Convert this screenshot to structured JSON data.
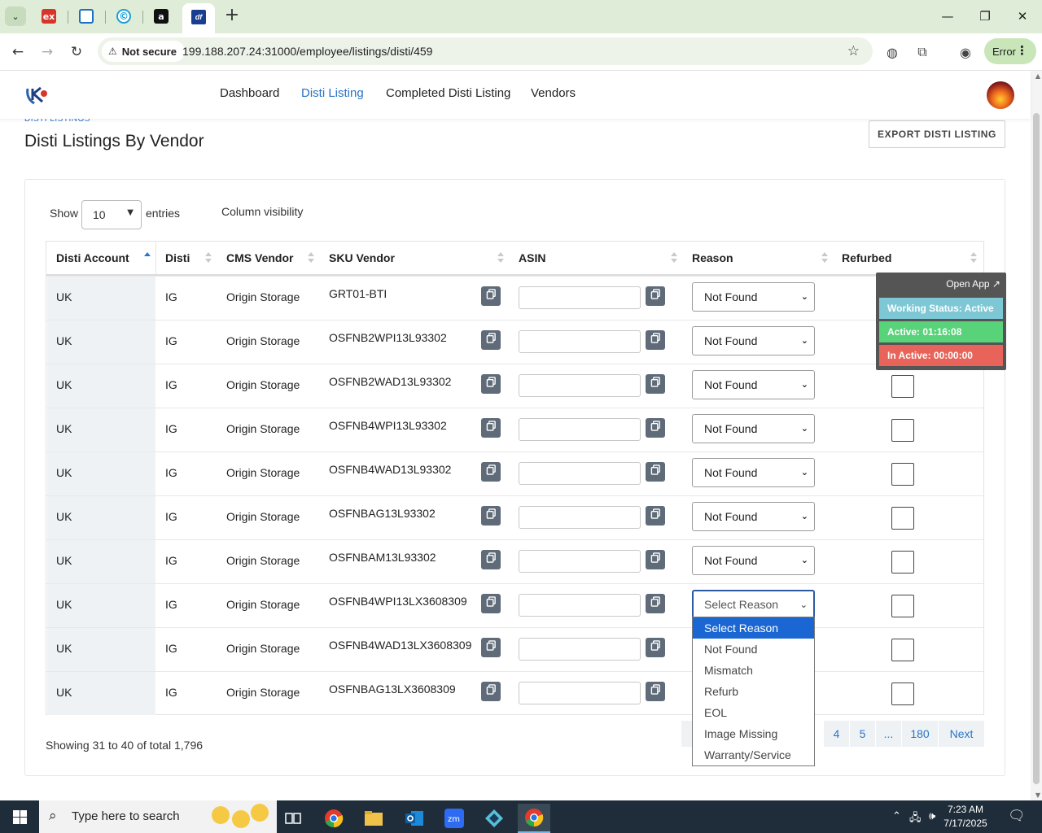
{
  "browser": {
    "security_chip": "Not secure",
    "url": "199.188.207.24:31000/employee/listings/disti/459",
    "profile_button": "Error",
    "tab_favicons": [
      "ex",
      "",
      "©",
      "a",
      "df"
    ]
  },
  "header": {
    "nav": [
      "Dashboard",
      "Disti Listing",
      "Completed Disti Listing",
      "Vendors"
    ],
    "active_nav": "Disti Listing"
  },
  "page": {
    "breadcrumb": "DISTI LISTINGS",
    "title": "Disti Listings By Vendor",
    "export_label": "EXPORT DISTI LISTING"
  },
  "table_controls": {
    "show_label": "Show",
    "entries_value": "10",
    "entries_label": "entries",
    "column_visibility": "Column visibility"
  },
  "table": {
    "columns": [
      "Disti Account",
      "Disti",
      "CMS Vendor",
      "SKU Vendor",
      "ASIN",
      "Reason",
      "Refurbed"
    ],
    "sorted_column": "Disti Account",
    "rows": [
      {
        "account": "UK",
        "disti": "IG",
        "cms_vendor": "Origin Storage",
        "sku": "GRT01-BTI",
        "asin": "",
        "reason": "Not Found",
        "refurbed": false
      },
      {
        "account": "UK",
        "disti": "IG",
        "cms_vendor": "Origin Storage",
        "sku": "OSFNB2WPI13L93302",
        "asin": "",
        "reason": "Not Found",
        "refurbed": false
      },
      {
        "account": "UK",
        "disti": "IG",
        "cms_vendor": "Origin Storage",
        "sku": "OSFNB2WAD13L93302",
        "asin": "",
        "reason": "Not Found",
        "refurbed": false
      },
      {
        "account": "UK",
        "disti": "IG",
        "cms_vendor": "Origin Storage",
        "sku": "OSFNB4WPI13L93302",
        "asin": "",
        "reason": "Not Found",
        "refurbed": false
      },
      {
        "account": "UK",
        "disti": "IG",
        "cms_vendor": "Origin Storage",
        "sku": "OSFNB4WAD13L93302",
        "asin": "",
        "reason": "Not Found",
        "refurbed": false
      },
      {
        "account": "UK",
        "disti": "IG",
        "cms_vendor": "Origin Storage",
        "sku": "OSFNBAG13L93302",
        "asin": "",
        "reason": "Not Found",
        "refurbed": false
      },
      {
        "account": "UK",
        "disti": "IG",
        "cms_vendor": "Origin Storage",
        "sku": "OSFNBAM13L93302",
        "asin": "",
        "reason": "Not Found",
        "refurbed": false
      },
      {
        "account": "UK",
        "disti": "IG",
        "cms_vendor": "Origin Storage",
        "sku": "OSFNB4WPI13LX3608309",
        "asin": "",
        "reason": "Select Reason",
        "refurbed": false
      },
      {
        "account": "UK",
        "disti": "IG",
        "cms_vendor": "Origin Storage",
        "sku": "OSFNB4WAD13LX3608309",
        "asin": "",
        "reason": "",
        "refurbed": false
      },
      {
        "account": "UK",
        "disti": "IG",
        "cms_vendor": "Origin Storage",
        "sku": "OSFNBAG13LX3608309",
        "asin": "",
        "reason": "",
        "refurbed": false
      }
    ]
  },
  "reason_dropdown": {
    "options": [
      "Select Reason",
      "Not Found",
      "Mismatch",
      "Refurb",
      "EOL",
      "Image Missing",
      "Warranty/Service"
    ],
    "highlighted": "Select Reason"
  },
  "footer": {
    "showing": "Showing 31 to 40 of total 1,796",
    "pages": [
      "4",
      "5",
      "...",
      "180"
    ],
    "next": "Next"
  },
  "timer_widget": {
    "open_app": "Open App ↗",
    "working_status": "Working Status: Active",
    "active": "Active: 01:16:08",
    "inactive": "In Active: 00:00:00",
    "colors": {
      "status": "#7ec8d6",
      "active": "#58d37a",
      "inactive": "#e8645a"
    }
  },
  "taskbar": {
    "search_placeholder": "Type here to search",
    "time": "7:23 AM",
    "date": "7/17/2025"
  }
}
